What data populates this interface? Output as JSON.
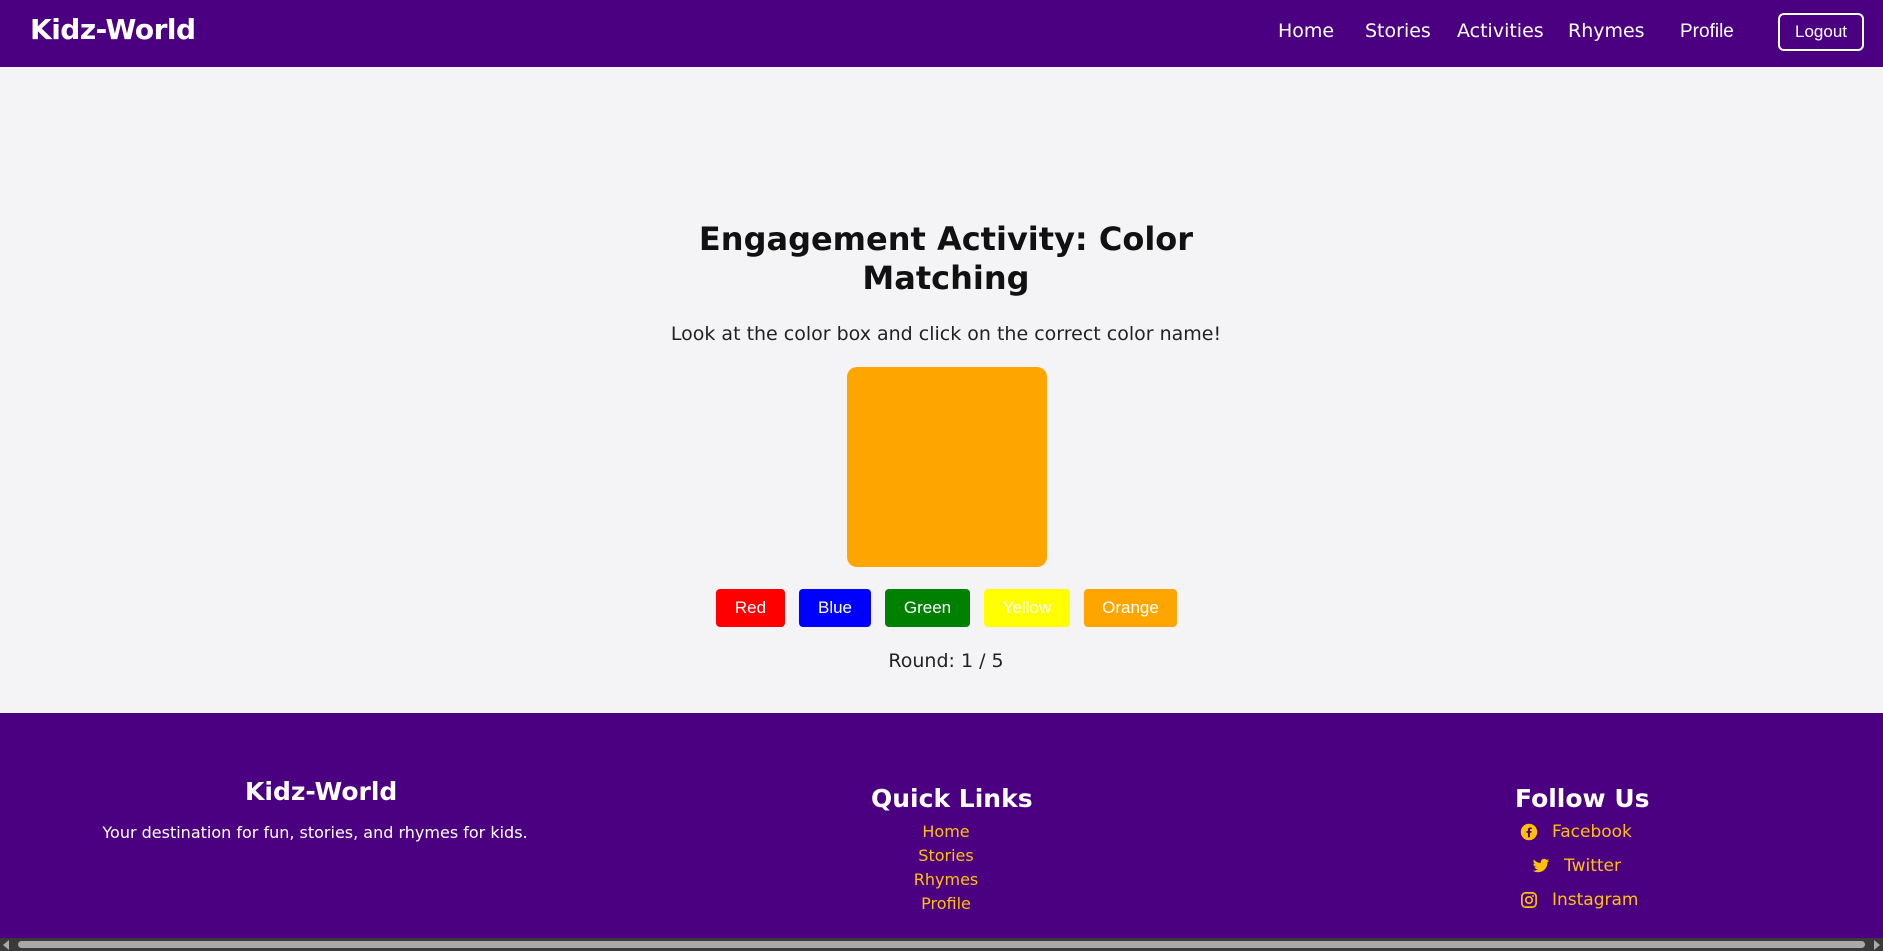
{
  "navbar": {
    "logo": "Kidz-World",
    "links": [
      "Home",
      "Stories",
      "Activities",
      "Rhymes",
      "Profile"
    ],
    "logout_label": "Logout"
  },
  "activity": {
    "title": "Engagement Activity: Color Matching",
    "instructions": "Look at the color box and click on the correct color name!",
    "current_color": "#ffa500",
    "choices": [
      {
        "label": "Red",
        "color": "#ff0000"
      },
      {
        "label": "Blue",
        "color": "#0000ff"
      },
      {
        "label": "Green",
        "color": "#008000"
      },
      {
        "label": "Yellow",
        "color": "#ffff00"
      },
      {
        "label": "Orange",
        "color": "#ffa500"
      }
    ],
    "round_label": "Round: 1 / 5"
  },
  "footer": {
    "brand": "Kidz-World",
    "tagline": "Your destination for fun, stories, and rhymes for kids.",
    "quick_links_heading": "Quick Links",
    "quick_links": [
      "Home",
      "Stories",
      "Rhymes",
      "Profile"
    ],
    "follow_heading": "Follow Us",
    "social": [
      {
        "label": "Facebook",
        "icon": "facebook-icon"
      },
      {
        "label": "Twitter",
        "icon": "twitter-icon"
      },
      {
        "label": "Instagram",
        "icon": "instagram-icon"
      }
    ]
  },
  "colors": {
    "brand_purple": "#4b0082",
    "link_gold": "#ffc107",
    "page_bg": "#f4f4f6"
  }
}
